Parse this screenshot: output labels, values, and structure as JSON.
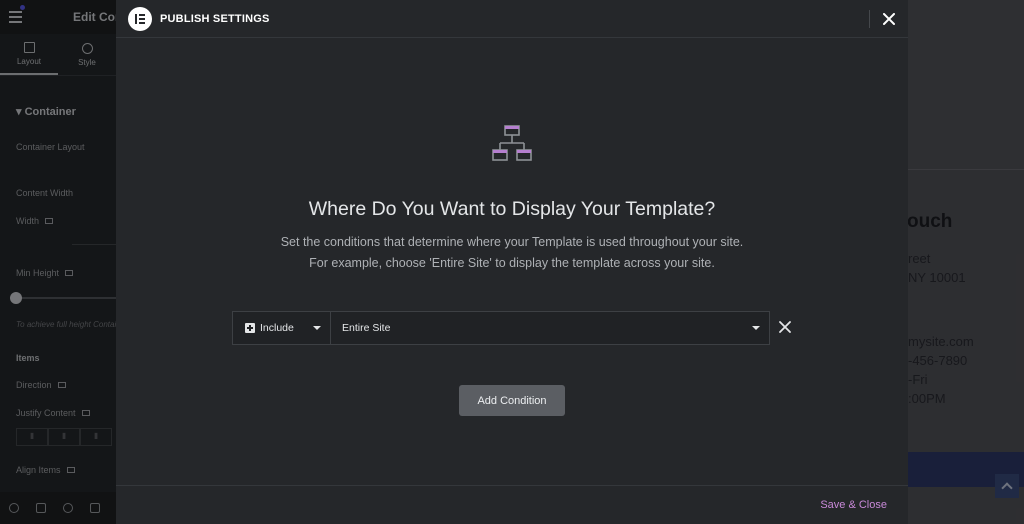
{
  "editor": {
    "title": "Edit Container",
    "tabs": [
      {
        "label": "Layout",
        "icon": "layout-icon"
      },
      {
        "label": "Style",
        "icon": "style-icon"
      }
    ],
    "section": "Container",
    "rows": {
      "container_layout": "Container Layout",
      "content_width": "Content Width",
      "width": "Width",
      "min_height": "Min Height",
      "note": "To achieve full height Container",
      "items": "Items",
      "direction": "Direction",
      "justify_content": "Justify Content",
      "align_items": "Align Items"
    }
  },
  "modal": {
    "title": "PUBLISH SETTINGS",
    "heading": "Where Do You Want to Display Your Template?",
    "description_line1": "Set the conditions that determine where your Template is used throughout your site.",
    "description_line2": "For example, choose 'Entire Site' to display the template across your site.",
    "condition": {
      "type": "Include",
      "target": "Entire Site"
    },
    "add_condition_label": "Add Condition",
    "save_close_label": "Save & Close"
  },
  "preview": {
    "heading": "ouch",
    "lines": [
      "reet",
      "NY 10001",
      "mysite.com",
      "-456-7890",
      "-Fri",
      ":00PM"
    ]
  },
  "colors": {
    "modal_bg": "#25272a",
    "accent": "#c889d8",
    "button_bg": "#5b5e63"
  }
}
